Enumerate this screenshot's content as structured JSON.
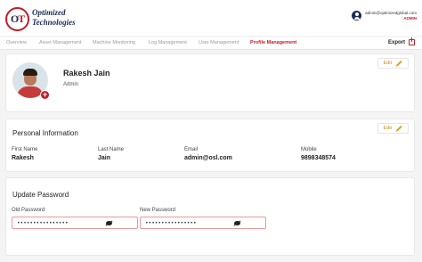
{
  "brand": {
    "logo_letters_1": "O",
    "logo_letters_2": "T",
    "line1": "Optimized",
    "line2": "Technologies"
  },
  "user": {
    "email": "admin@optimizedglobal.com",
    "role": "ADMIN"
  },
  "nav": {
    "tabs": [
      {
        "label": "Overview"
      },
      {
        "label": "Asset Management"
      },
      {
        "label": "Machine Monitoring"
      },
      {
        "label": "Log Management"
      },
      {
        "label": "User Management"
      },
      {
        "label": "Profile Management",
        "active": true
      }
    ],
    "export_label": "Export"
  },
  "profile": {
    "name": "Rakesh Jain",
    "role": "Admin",
    "edit_label": "Edit",
    "avatar_add": "+"
  },
  "personal": {
    "title": "Personal Information",
    "edit_label": "Edit",
    "fields": [
      {
        "label": "First Name",
        "value": "Rakesh"
      },
      {
        "label": "Last Name",
        "value": "Jain"
      },
      {
        "label": "Email",
        "value": "admin@osl.com"
      },
      {
        "label": "Mobile",
        "value": "9898348574"
      }
    ]
  },
  "password": {
    "title": "Update Password",
    "old_label": "Old Password",
    "old_value": "••••••••••••••••",
    "new_label": "New Password",
    "new_value": "••••••••••••••••"
  },
  "colors": {
    "accent": "#c01d2a",
    "brand_navy": "#1f2a55",
    "edit": "#c48a1a"
  }
}
